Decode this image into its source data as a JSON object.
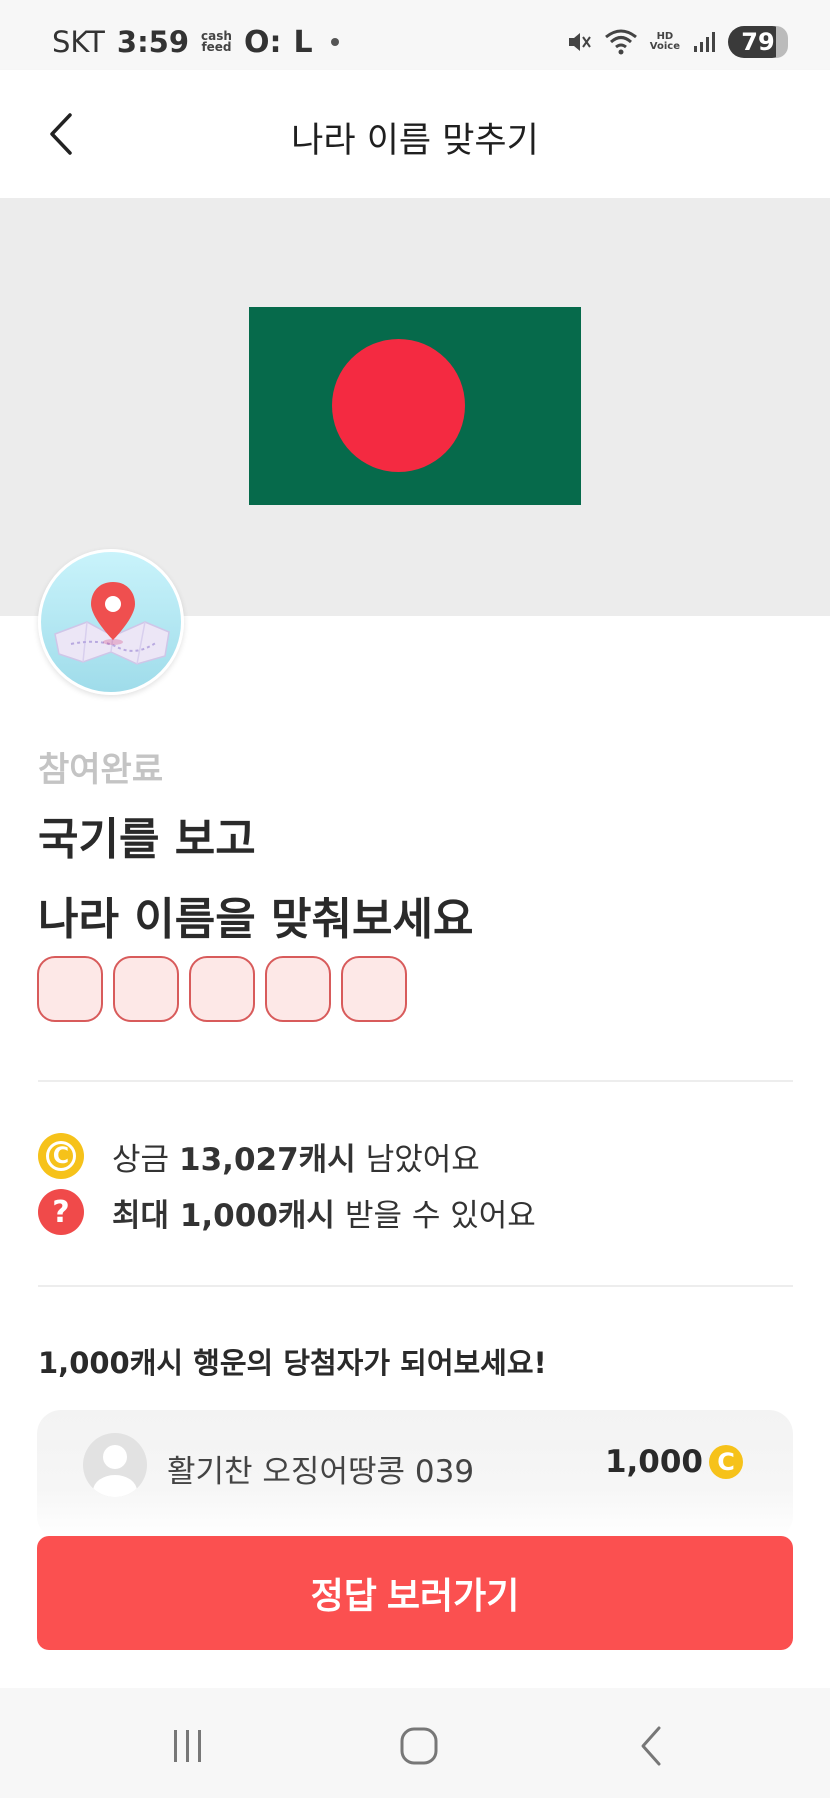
{
  "status_bar": {
    "carrier": "SKT",
    "time": "3:59",
    "app_badge_top": "cash",
    "app_badge_bottom": "feed",
    "glyph_1": "O:",
    "glyph_2": "L",
    "hd_top": "HD",
    "hd_bottom": "Voice",
    "battery": "79",
    "icons": [
      "mute-icon",
      "wifi-icon",
      "hd-voice-icon",
      "signal-icon",
      "battery-icon"
    ]
  },
  "header": {
    "title": "나라 이름 맞추기",
    "back_icon": "chevron-left-icon"
  },
  "hero": {
    "flag_colors": {
      "field": "#066a4b",
      "disc": "#f42a41"
    },
    "quiz_icon": "map-pin-icon"
  },
  "quiz": {
    "status": "참여완료",
    "question_line1": "국기를 보고",
    "question_line2": "나라 이름을 맞춰보세요",
    "answer_slots": [
      "",
      "",
      "",
      "",
      ""
    ]
  },
  "info": {
    "prize_prefix": "상금",
    "prize_amount": "13,027캐시",
    "prize_suffix": "남았어요",
    "max_amount": "최대 1,000캐시",
    "max_suffix": "받을 수 있어요",
    "coin_symbol": "C",
    "help_symbol": "?"
  },
  "winners": {
    "heading": "1,000캐시 행운의 당첨자가 되어보세요!",
    "entry_name": "활기찬 오징어땅콩 039",
    "entry_amount": "1,000",
    "coin_symbol": "C"
  },
  "cta": {
    "label": "정답 보러가기"
  },
  "nav": {
    "recents_label": "|||"
  },
  "colors": {
    "accent": "#fb5050",
    "coin": "#f6c21a",
    "help": "#f04a4a"
  }
}
